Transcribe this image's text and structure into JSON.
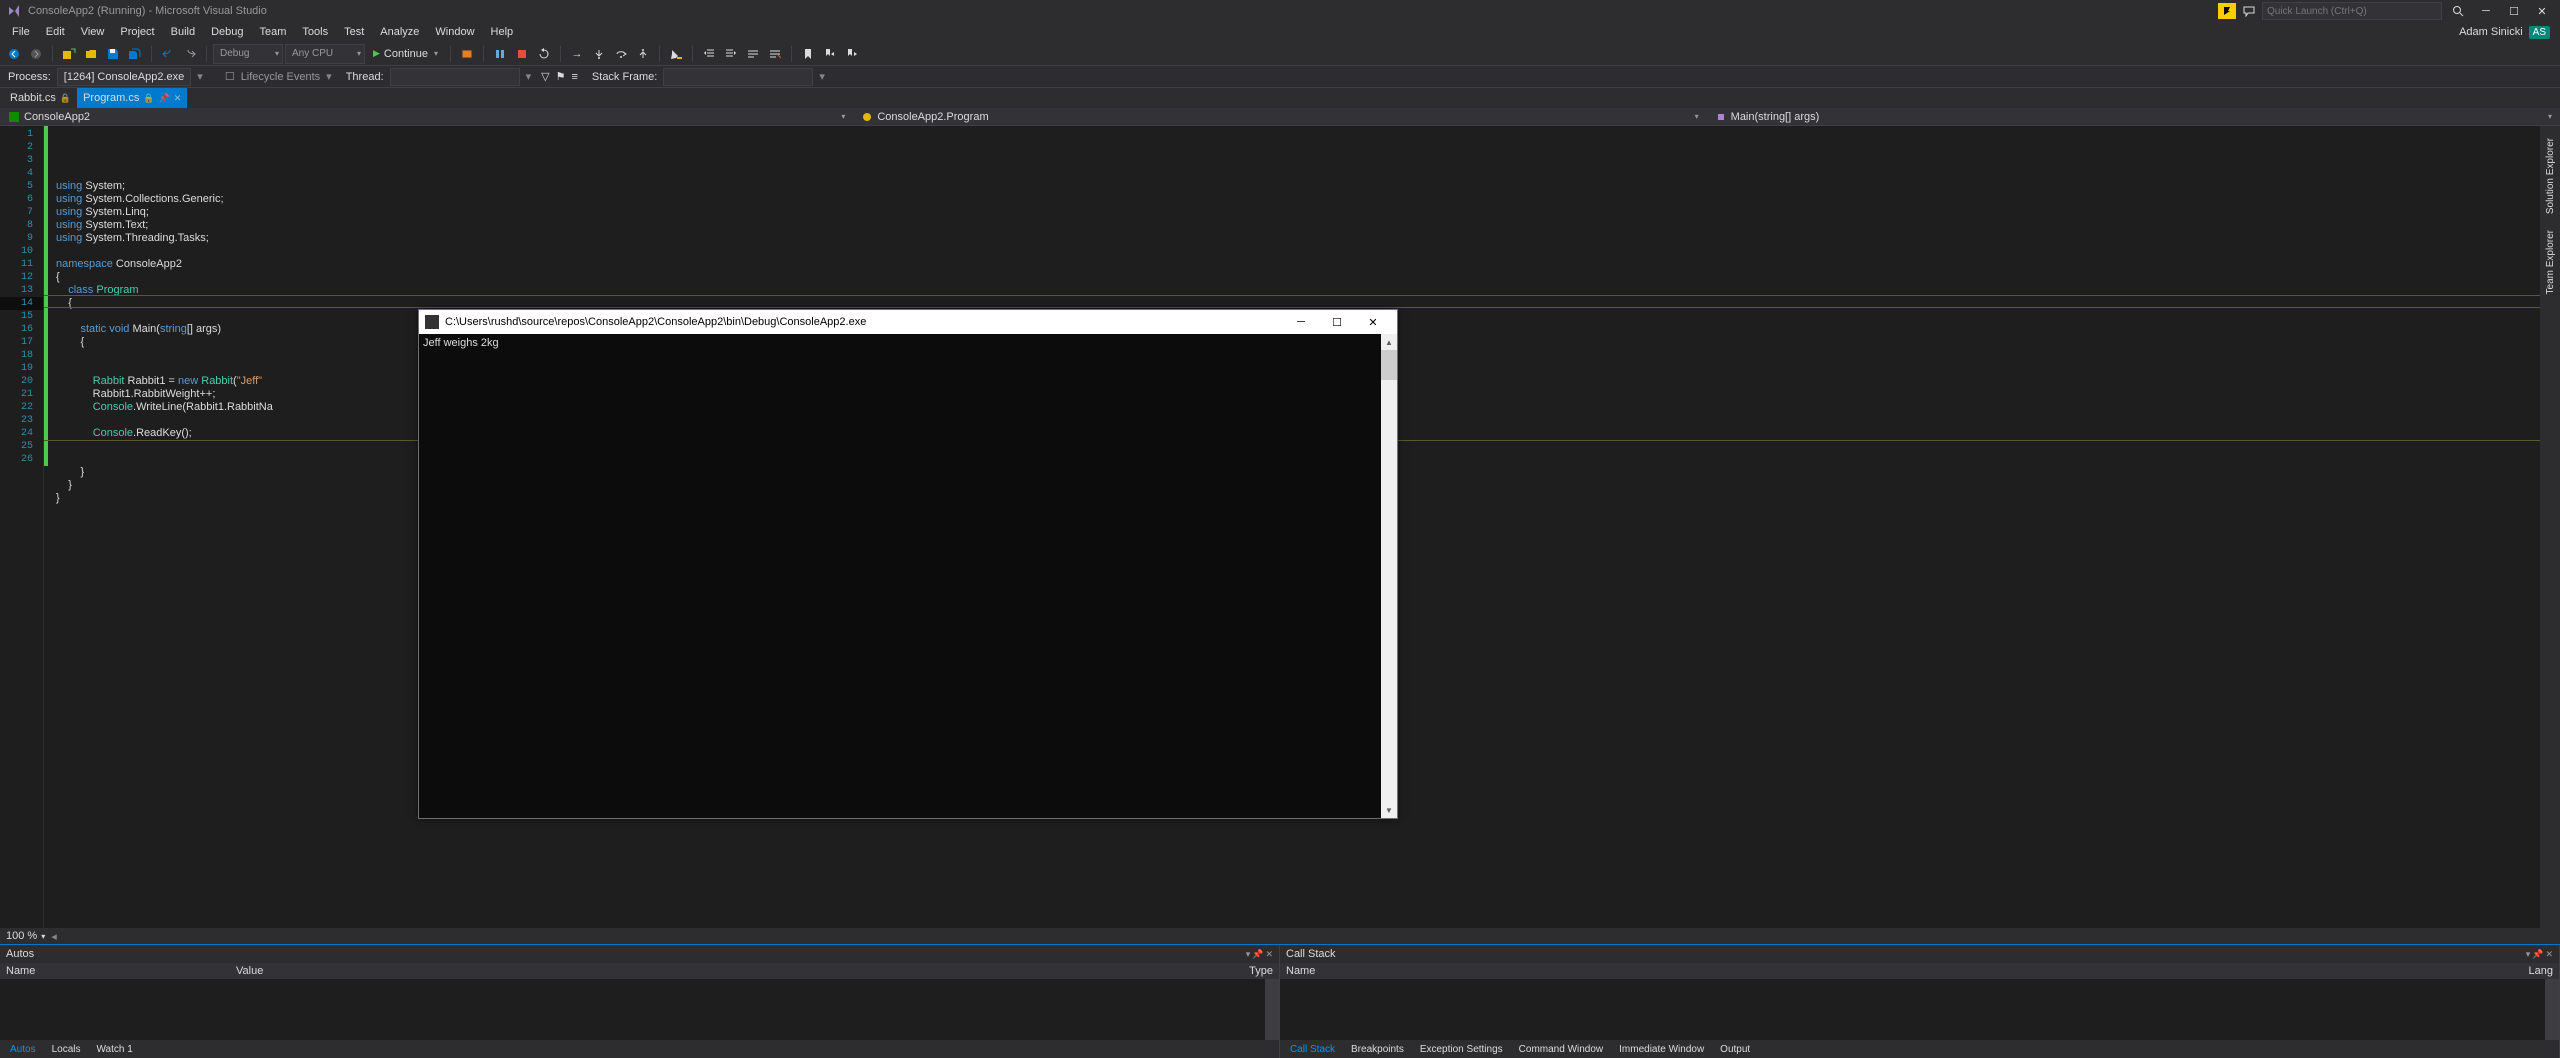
{
  "title": "ConsoleApp2 (Running) - Microsoft Visual Studio",
  "quick_launch_placeholder": "Quick Launch (Ctrl+Q)",
  "user": {
    "name": "Adam Sinicki",
    "initials": "AS"
  },
  "menu": [
    "File",
    "Edit",
    "View",
    "Project",
    "Build",
    "Debug",
    "Team",
    "Tools",
    "Test",
    "Analyze",
    "Window",
    "Help"
  ],
  "toolbar": {
    "solution_config": "Debug",
    "platform": "Any CPU",
    "continue": "Continue"
  },
  "processbar": {
    "process_label": "Process:",
    "process_value": "[1264] ConsoleApp2.exe",
    "lifecycle": "Lifecycle Events",
    "thread_label": "Thread:",
    "thread_value": "",
    "stackframe_label": "Stack Frame:",
    "stackframe_value": ""
  },
  "tabs": [
    {
      "name": "Rabbit.cs",
      "active": false,
      "locked": true
    },
    {
      "name": "Program.cs",
      "active": true,
      "locked": true
    }
  ],
  "navbar": {
    "left": "ConsoleApp2",
    "mid": "ConsoleApp2.Program",
    "right": "Main(string[] args)"
  },
  "code_lines": [
    {
      "n": 1,
      "txt": [
        [
          "kw",
          "using"
        ],
        [
          "id",
          " System;"
        ]
      ]
    },
    {
      "n": 2,
      "txt": [
        [
          "kw",
          "using"
        ],
        [
          "id",
          " System.Collections.Generic;"
        ]
      ]
    },
    {
      "n": 3,
      "txt": [
        [
          "kw",
          "using"
        ],
        [
          "id",
          " System.Linq;"
        ]
      ]
    },
    {
      "n": 4,
      "txt": [
        [
          "kw",
          "using"
        ],
        [
          "id",
          " System.Text;"
        ]
      ]
    },
    {
      "n": 5,
      "txt": [
        [
          "kw",
          "using"
        ],
        [
          "id",
          " System.Threading.Tasks;"
        ]
      ]
    },
    {
      "n": 6,
      "txt": []
    },
    {
      "n": 7,
      "txt": [
        [
          "kw",
          "namespace"
        ],
        [
          "id",
          " ConsoleApp2"
        ]
      ]
    },
    {
      "n": 8,
      "txt": [
        [
          "id",
          "{"
        ]
      ]
    },
    {
      "n": 9,
      "txt": [
        [
          "id",
          "    "
        ],
        [
          "kw",
          "class"
        ],
        [
          "id",
          " "
        ],
        [
          "type",
          "Program"
        ]
      ]
    },
    {
      "n": 10,
      "txt": [
        [
          "id",
          "    {"
        ]
      ]
    },
    {
      "n": 11,
      "txt": []
    },
    {
      "n": 12,
      "txt": [
        [
          "id",
          "        "
        ],
        [
          "kw",
          "static"
        ],
        [
          "id",
          " "
        ],
        [
          "kw",
          "void"
        ],
        [
          "id",
          " Main("
        ],
        [
          "kw",
          "string"
        ],
        [
          "id",
          "[] args)"
        ]
      ]
    },
    {
      "n": 13,
      "txt": [
        [
          "id",
          "        {"
        ]
      ]
    },
    {
      "n": 14,
      "txt": []
    },
    {
      "n": 15,
      "txt": []
    },
    {
      "n": 16,
      "txt": [
        [
          "id",
          "            "
        ],
        [
          "type",
          "Rabbit"
        ],
        [
          "id",
          " Rabbit1 = "
        ],
        [
          "kw",
          "new"
        ],
        [
          "id",
          " "
        ],
        [
          "type",
          "Rabbit"
        ],
        [
          "id",
          "("
        ],
        [
          "str",
          "\"Jeff\""
        ]
      ]
    },
    {
      "n": 17,
      "txt": [
        [
          "id",
          "            Rabbit1.RabbitWeight++;"
        ]
      ]
    },
    {
      "n": 18,
      "txt": [
        [
          "id",
          "            "
        ],
        [
          "type",
          "Console"
        ],
        [
          "id",
          ".WriteLine(Rabbit1.RabbitNa"
        ]
      ]
    },
    {
      "n": 19,
      "txt": []
    },
    {
      "n": 20,
      "txt": [
        [
          "id",
          "            "
        ],
        [
          "type",
          "Console"
        ],
        [
          "id",
          ".ReadKey();"
        ]
      ]
    },
    {
      "n": 21,
      "txt": []
    },
    {
      "n": 22,
      "txt": []
    },
    {
      "n": 23,
      "txt": [
        [
          "id",
          "        }"
        ]
      ]
    },
    {
      "n": 24,
      "txt": [
        [
          "id",
          "    }"
        ]
      ]
    },
    {
      "n": 25,
      "txt": [
        [
          "id",
          "}"
        ]
      ]
    },
    {
      "n": 26,
      "txt": []
    }
  ],
  "editor_footer": {
    "zoom": "100 %"
  },
  "right_tools": [
    "Solution Explorer",
    "Team Explorer"
  ],
  "bottom": {
    "autos": {
      "title": "Autos",
      "cols": [
        "Name",
        "Value",
        "Type"
      ],
      "tabs": [
        "Autos",
        "Locals",
        "Watch 1"
      ]
    },
    "callstack": {
      "title": "Call Stack",
      "cols": [
        "Name",
        "Lang"
      ],
      "tabs": [
        "Call Stack",
        "Breakpoints",
        "Exception Settings",
        "Command Window",
        "Immediate Window",
        "Output"
      ]
    }
  },
  "console": {
    "title": "C:\\Users\\rushd\\source\\repos\\ConsoleApp2\\ConsoleApp2\\bin\\Debug\\ConsoleApp2.exe",
    "output": "Jeff weighs 2kg"
  }
}
